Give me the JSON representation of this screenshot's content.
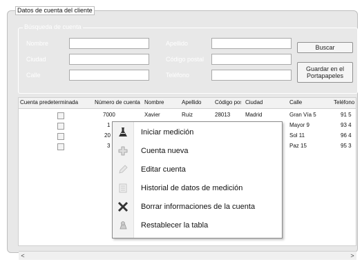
{
  "window": {
    "title": "Datos de cuenta del cliente"
  },
  "search": {
    "title": "Búsqueda de cuenta",
    "labels": {
      "nombre": "Nombre",
      "ciudad": "Ciudad",
      "calle": "Calle",
      "apellido": "Apellido",
      "codigo_postal": "Código postal",
      "telefono": "Teléfono"
    },
    "values": {
      "nombre": "",
      "ciudad": "",
      "calle": "",
      "apellido": "",
      "codigo_postal": "",
      "telefono": ""
    },
    "buttons": {
      "buscar": "Buscar",
      "guardar": "Guardar en el Portapapeles"
    }
  },
  "table": {
    "columns": [
      "Cuenta predeterminada",
      "Número de cuenta",
      "Nombre",
      "Apellido",
      "Código postal",
      "Ciudad",
      "Calle",
      "Teléfono"
    ],
    "rows": [
      {
        "num": "7000",
        "nombre": "Xavier",
        "apellido": "Ruiz",
        "cp": "28013",
        "ciudad": "Madrid",
        "calle": "Gran Vía 5",
        "tel": "91 5"
      },
      {
        "num": "1",
        "nombre": "",
        "apellido": "",
        "cp": "",
        "ciudad": "",
        "calle": "Mayor 9",
        "tel": "93 4"
      },
      {
        "num": "20",
        "nombre": "",
        "apellido": "",
        "cp": "",
        "ciudad": "",
        "calle": "Sol 11",
        "tel": "96 4"
      },
      {
        "num": "3",
        "nombre": "",
        "apellido": "",
        "cp": "",
        "ciudad": "",
        "calle": "Paz 15",
        "tel": "95 3"
      }
    ]
  },
  "context_menu": {
    "items": [
      {
        "label": "Iniciar medición",
        "icon": "flask-icon"
      },
      {
        "label": "Cuenta nueva",
        "icon": "add-account-icon"
      },
      {
        "label": "Editar cuenta",
        "icon": "edit-pencil-icon"
      },
      {
        "label": "Historial de datos de medición",
        "icon": "history-list-icon"
      },
      {
        "label": "Borrar informaciones de la cuenta",
        "icon": "delete-x-icon"
      },
      {
        "label": "Restablecer la tabla",
        "icon": "reset-table-icon"
      }
    ]
  },
  "scrollbar": {
    "left": "<",
    "right": ">"
  }
}
